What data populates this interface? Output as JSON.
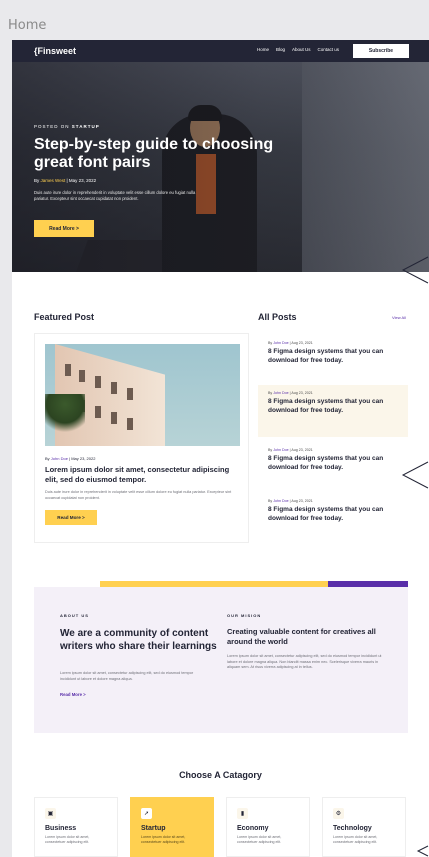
{
  "frame": {
    "label": "Home"
  },
  "header": {
    "logo": "{Finsweet",
    "nav": [
      "Home",
      "Blog",
      "About Us",
      "Contact us"
    ],
    "subscribe": "Subscribe"
  },
  "hero": {
    "posted_prefix": "POSTED ON",
    "posted_category": "STARTUP",
    "title": "Step-by-step guide to choosing great font pairs",
    "meta_prefix": "By",
    "author": "James West",
    "date": "May 23, 2022",
    "description": "Duis aute irure dolor in reprehenderit in voluptate velit esse cillum dolore eu fugiat nulla pariatur. Excepteur sint occaecat cupidatat non proident.",
    "button": "Read More >"
  },
  "featured": {
    "section_title": "Featured Post",
    "meta_prefix": "By",
    "author": "John Doe",
    "date": "May 23, 2022",
    "title": "Lorem ipsum dolor sit amet, consectetur adipiscing elit, sed do eiusmod tempor.",
    "description": "Duis aute irure dolor in reprehenderit in voluptate velit esse cillum dolore eu fugiat nulla pariatur. Excepteur sint occaecat cupidatat non proident.",
    "button": "Read More >"
  },
  "all_posts": {
    "section_title": "All Posts",
    "view_all": "View All",
    "posts": [
      {
        "meta_prefix": "By",
        "author": "John Doe",
        "date": "Aug 23, 2021",
        "title": "8 Figma design systems that you can download for free today."
      },
      {
        "meta_prefix": "By",
        "author": "John Doe",
        "date": "Aug 23, 2021",
        "title": "8 Figma design systems that you can download for free today."
      },
      {
        "meta_prefix": "By",
        "author": "John Doe",
        "date": "Aug 23, 2021",
        "title": "8 Figma design systems that you can download for free today."
      },
      {
        "meta_prefix": "By",
        "author": "John Doe",
        "date": "Aug 23, 2021",
        "title": "8 Figma design systems that you can download for free today."
      }
    ]
  },
  "about": {
    "label": "ABOUT US",
    "heading": "We are a community of content writers who share their learnings",
    "text": "Lorem ipsum dolor sit amet, consectetur adipiscing elit, sed do eiusmod tempor incididunt ut labore et dolore magna aliqua.",
    "link": "Read More >",
    "mission_label": "OUR MISION",
    "mission_heading": "Creating valuable content for creatives all around the world",
    "mission_text": "Lorem ipsum dolor sit amet, consectetur adipiscing elit, sed do eiusmod tempor incididunt ut labore et dolore magna aliqua. Non blandit massa enim nec. Scelerisque viverra mauris in aliquam sem. At risus viverra adipiscing at in tellus."
  },
  "categories": {
    "title": "Choose A Catagory",
    "items": [
      {
        "name": "Business",
        "icon": "briefcase-icon",
        "glyph": "▣",
        "desc": "Lorem ipsum dolor sit amet, consectetuer adipiscing elit."
      },
      {
        "name": "Startup",
        "icon": "rocket-icon",
        "glyph": "➚",
        "desc": "Lorem ipsum dolor sit amet, consectetuer adipiscing elit."
      },
      {
        "name": "Economy",
        "icon": "chart-icon",
        "glyph": "▮",
        "desc": "Lorem ipsum dolor sit amet, consectetuer adipiscing elit."
      },
      {
        "name": "Technology",
        "icon": "cpu-icon",
        "glyph": "⚙",
        "desc": "Lorem ipsum dolor sit amet, consectetuer adipiscing elit."
      }
    ]
  },
  "colors": {
    "dark": "#232536",
    "accent_yellow": "#FFD050",
    "accent_purple": "#592EA9"
  }
}
